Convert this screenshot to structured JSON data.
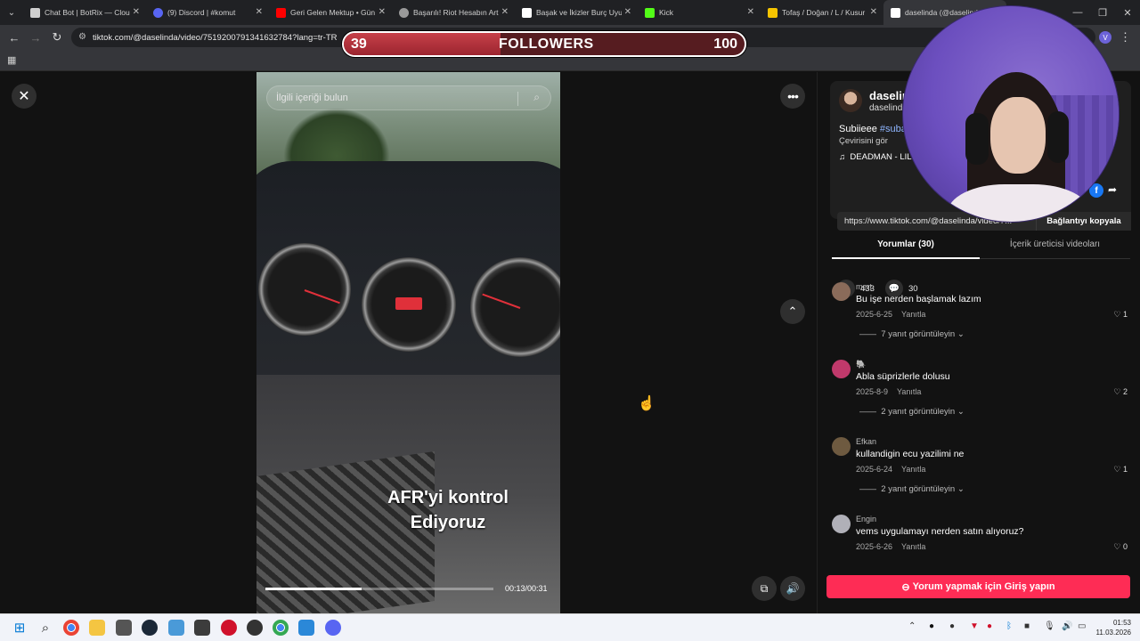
{
  "browser": {
    "tabs": [
      {
        "title": "Chat Bot | BotRix — Cloud",
        "color": "#cfcfcf"
      },
      {
        "title": "(9) Discord | #komut",
        "color": "#5865f2"
      },
      {
        "title": "Geri Gelen Mektup • Gün",
        "color": "#ff0000"
      },
      {
        "title": "Başarılı! Riot Hesabın Art",
        "color": "#d0d0d0"
      },
      {
        "title": "Başak ve İkizler Burç Uyum",
        "color": "#ffffff"
      },
      {
        "title": "Kick",
        "color": "#53fc18"
      },
      {
        "title": "Tofaş / Doğan / L / Kusur",
        "color": "#f5c400"
      },
      {
        "title": "daselinda (@daselinda)",
        "color": "#ffffff"
      }
    ],
    "url": "tiktok.com/@daselinda/video/7519200791341632784?lang=tr-TR",
    "profile_initial": "V"
  },
  "goal": {
    "current": "39",
    "label": "FOLLOWERS",
    "target": "100",
    "progress": 0.39
  },
  "video": {
    "search_placeholder": "İlgili içeriği bulun",
    "caption_line1": "AFR'yi kontrol",
    "caption_line2": "Ediyoruz",
    "time": "00:13/00:31",
    "progress": 0.42
  },
  "post": {
    "username": "daselin",
    "handle": "daselinda",
    "desc_text": "Subiieee ",
    "desc_tag": "#suba",
    "translate": "Çevirisini gör",
    "music": "DEADMAN - LIL",
    "likes": "433",
    "comments": "30",
    "link": "https://www.tiktok.com/@daselinda/video/7...",
    "copy_label": "Bağlantıyı kopyala"
  },
  "tabs": {
    "comments": "Yorumlar (30)",
    "creator": "İçerik üreticisi videoları"
  },
  "comments": [
    {
      "name": "mert",
      "text": "Bu işe nerden başlamak lazım",
      "date": "2025-6-25",
      "reply": "Yanıtla",
      "likes": "1",
      "replies": "7 yanıt görüntüleyin",
      "color": "#8a6b5a"
    },
    {
      "name": "🐘",
      "text": "Abla süprizlerle dolusu",
      "date": "2025-8-9",
      "reply": "Yanıtla",
      "likes": "2",
      "replies": "2 yanıt görüntüleyin",
      "color": "#c0396b"
    },
    {
      "name": "Efkan",
      "text": "kullandigin ecu yazilimi ne",
      "date": "2025-6-24",
      "reply": "Yanıtla",
      "likes": "1",
      "replies": "2 yanıt görüntüleyin",
      "color": "#6e5a40"
    },
    {
      "name": "Engin",
      "text": "vems uygulamayı nerden satın alıyoruz?",
      "date": "2025-6-26",
      "reply": "Yanıtla",
      "likes": "0",
      "replies": "",
      "color": "#b0b0b8"
    }
  ],
  "login_label": "Yorum yapmak için Giriş yapın",
  "taskbar": {
    "time": "01:53",
    "date": "11.03.2026"
  }
}
